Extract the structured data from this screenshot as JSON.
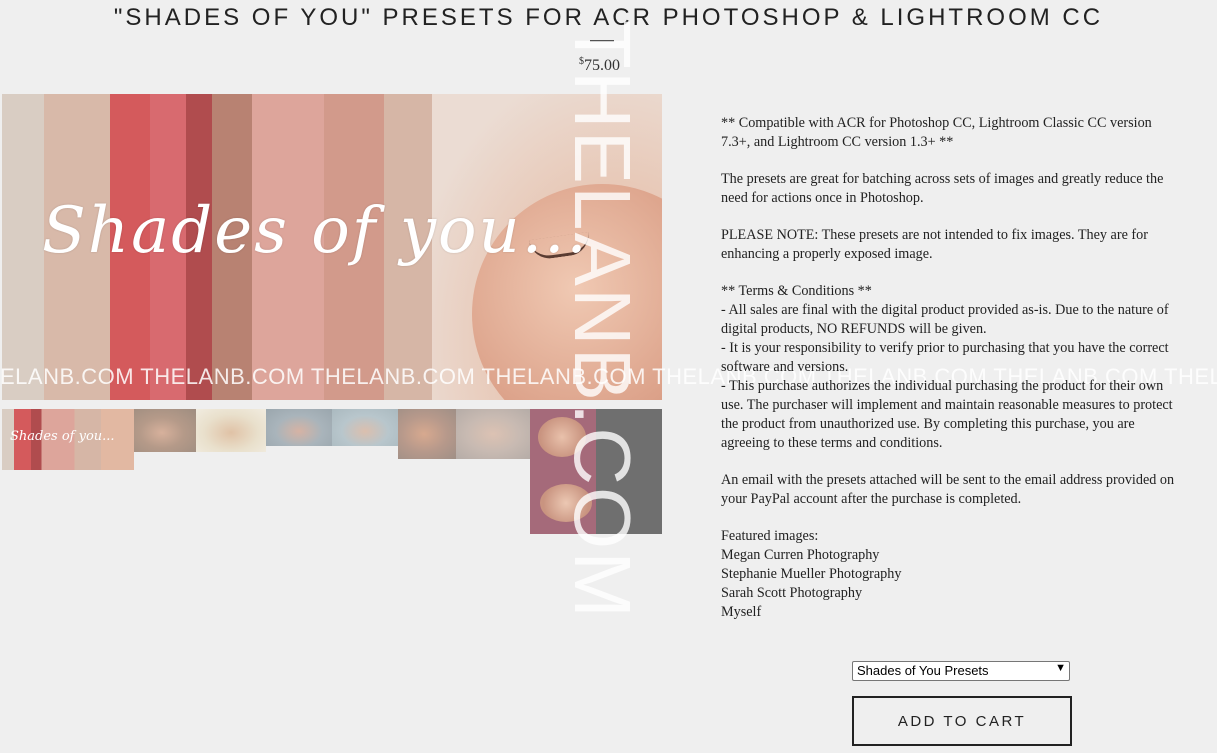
{
  "product": {
    "title": "\"SHADES OF YOU\" PRESETS FOR ACR PHOTOSHOP & LIGHTROOM CC",
    "price_symbol": "$",
    "price_value": "75.00"
  },
  "hero": {
    "script_text": "Shades of you..."
  },
  "watermark": {
    "horizontal": "ELANB.COM THELANB.COM THELANB.COM THELANB.COM THELANB.COM THELANB.COM THELANB.COM THELANB.COM",
    "vertical": "THELANB.COM"
  },
  "description": {
    "compat_line1": "** Compatible with ACR for Photoshop CC, Lightroom Classic CC version",
    "compat_line2": "7.3+, and Lightroom CC version 1.3+ **",
    "batch_line1": "The presets are great for batching across sets of images and greatly reduce the",
    "batch_line2": "need for actions once in Photoshop.",
    "note_line1": "PLEASE NOTE: These presets are not intended to fix images. They are for",
    "note_line2": "enhancing a properly exposed image.",
    "terms_heading": "** Terms & Conditions **",
    "terms_1a": "- All sales are final with the digital product provided as-is. Due to the nature of",
    "terms_1b": "digital products, NO REFUNDS will be given.",
    "terms_2a": "- It is your responsibility to verify prior to purchasing that you have the correct",
    "terms_2b": "software and versions.",
    "terms_3a": "- This purchase authorizes the individual purchasing the product for their own",
    "terms_3b": "use. The purchaser will implement and maintain reasonable measures to protect",
    "terms_3c": "the product from unauthorized use. By completing this purchase, you are",
    "terms_3d": "agreeing to these terms and conditions.",
    "email_line1": "An email with the presets attached will be sent to the email address provided on",
    "email_line2": "your PayPal account after the purchase is completed.",
    "featured_heading": "Featured images:",
    "featured": [
      "Megan Curren Photography",
      "Stephanie Mueller Photography",
      "Sarah Scott Photography",
      "Myself"
    ]
  },
  "purchase": {
    "variant_selected": "Shades of You Presets",
    "add_to_cart": "ADD TO CART"
  },
  "thumb_script": "Shades of you..."
}
